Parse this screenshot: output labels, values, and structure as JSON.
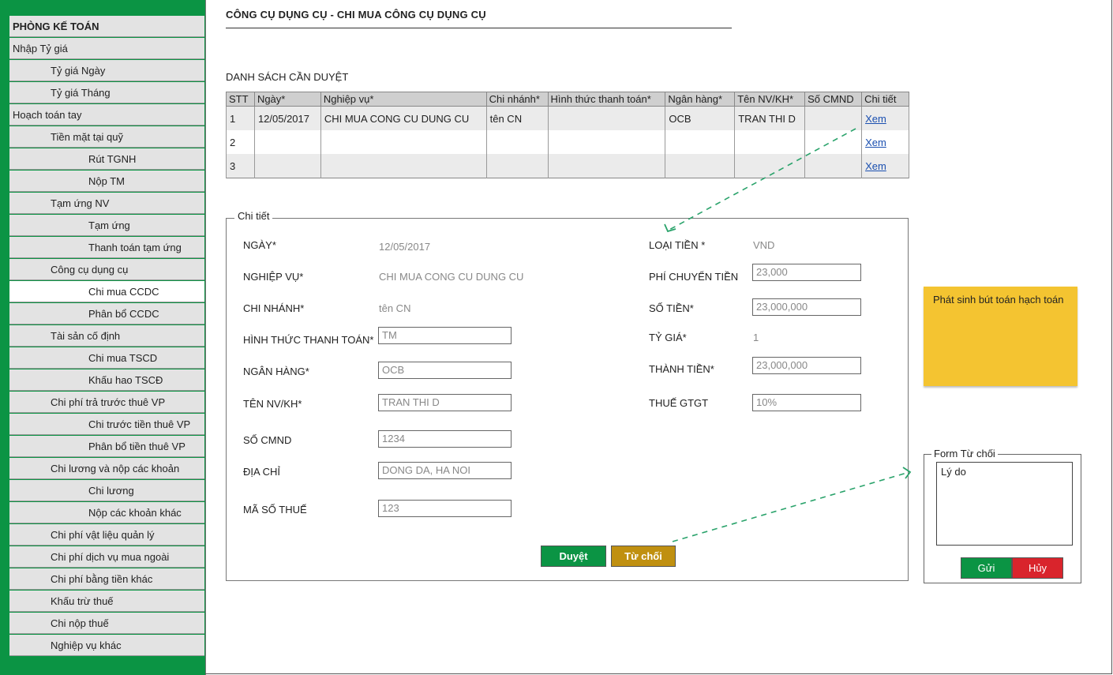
{
  "sidebar": {
    "items": [
      {
        "label": "PHÒNG KẾ TOÁN"
      },
      {
        "label": "Nhập Tỷ giá"
      },
      {
        "label": "Tỷ giá Ngày"
      },
      {
        "label": "Tỷ giá Tháng"
      },
      {
        "label": "Hoạch toán tay"
      },
      {
        "label": "Tiền mặt tại quỹ"
      },
      {
        "label": "Rút TGNH"
      },
      {
        "label": "Nộp TM"
      },
      {
        "label": "Tạm ứng NV"
      },
      {
        "label": "Tạm ứng"
      },
      {
        "label": "Thanh toán tạm ứng"
      },
      {
        "label": "Công cụ dụng cụ"
      },
      {
        "label": "Chi mua CCDC"
      },
      {
        "label": "Phân bổ CCDC"
      },
      {
        "label": "Tài sản cố định"
      },
      {
        "label": "Chi mua TSCD"
      },
      {
        "label": "Khấu hao TSCĐ"
      },
      {
        "label": "Chi phí trả trước thuê VP"
      },
      {
        "label": "Chi trước tiền thuê VP"
      },
      {
        "label": "Phân bổ tiền thuê VP"
      },
      {
        "label": "Chi lương và nộp các khoản"
      },
      {
        "label": "Chi lương"
      },
      {
        "label": "Nộp các khoản khác"
      },
      {
        "label": "Chi phí vật liệu quản lý"
      },
      {
        "label": "Chi phí dịch vụ mua ngoài"
      },
      {
        "label": "Chi phí bằng tiền khác"
      },
      {
        "label": "Khấu trừ thuế"
      },
      {
        "label": "Chi nộp thuế"
      },
      {
        "label": "Nghiệp vụ khác"
      }
    ],
    "active_label": "Chi mua CCDC",
    "accent_color": "#0b9444"
  },
  "header": {
    "title": "CÔNG CỤ DỤNG CỤ - CHI MUA CÔNG CỤ DỤNG CỤ"
  },
  "pending": {
    "title": "DANH SÁCH CẦN DUYỆT",
    "columns": [
      "STT",
      "Ngày*",
      "Nghiệp vụ*",
      "Chi nhánh*",
      "Hình thức thanh toán*",
      "Ngân hàng*",
      "Tên NV/KH*",
      "Số CMND",
      "Chi tiết"
    ],
    "rows": [
      [
        "1",
        "12/05/2017",
        "CHI MUA CONG CU DUNG CU",
        "tên CN",
        "",
        "OCB",
        "TRAN THI D",
        "",
        "Xem"
      ],
      [
        "2",
        "",
        "",
        "",
        "",
        "",
        "",
        "",
        "Xem"
      ],
      [
        "3",
        "",
        "",
        "",
        "",
        "",
        "",
        "",
        "Xem"
      ]
    ]
  },
  "detail": {
    "legend": "Chi tiết",
    "ngay_label": "NGÀY*",
    "ngay_value": "12/05/2017",
    "nghiepvu_label": "NGHIỆP VỤ*",
    "nghiepvu_value": "CHI MUA CONG CU DUNG CU",
    "chinhanh_label": "CHI NHÁNH*",
    "chinhanh_value": "tên CN",
    "hinhthuc_label": "HÌNH THỨC THANH TOÁN*",
    "hinhthuc_value": "TM",
    "nganhang_label": "NGÂN HÀNG*",
    "nganhang_value": "OCB",
    "tennv_label": "TÊN NV/KH*",
    "tennv_value": "TRAN THI D",
    "socmnd_label": "SỐ CMND",
    "socmnd_value": "1234",
    "diachi_label": "ĐỊA CHỈ",
    "diachi_value": "DONG DA, HA NOI",
    "masothue_label": "MÃ SỐ THUẾ",
    "masothue_value": "123",
    "loaitien_label": "LOẠI TIỀN *",
    "loaitien_value": "VND",
    "phichuyen_label": "PHÍ CHUYỂN TIỀN",
    "phichuyen_value": "23,000",
    "sotien_label": "SỐ TIỀN*",
    "sotien_value": "23,000,000",
    "tygia_label": "TỶ GIÁ*",
    "tygia_value": "1",
    "thanhtien_label": "THÀNH TIỀN*",
    "thanhtien_value": "23,000,000",
    "thue_label": "THUẾ GTGT",
    "thue_value": "10%",
    "approve_label": "Duyệt",
    "reject_label": "Từ chối"
  },
  "sticky": {
    "text": "Phát sinh bút toán hạch toán"
  },
  "reject_form": {
    "legend": "Form Từ chối",
    "reason_placeholder": "Lý do",
    "send_label": "Gửi",
    "cancel_label": "Hủy"
  },
  "colors": {
    "approve": "#0b9444",
    "reject": "#c09010",
    "send": "#0b9444",
    "cancel": "#d9242c",
    "sticky": "#f4c431",
    "arrow": "#2aa36b"
  }
}
